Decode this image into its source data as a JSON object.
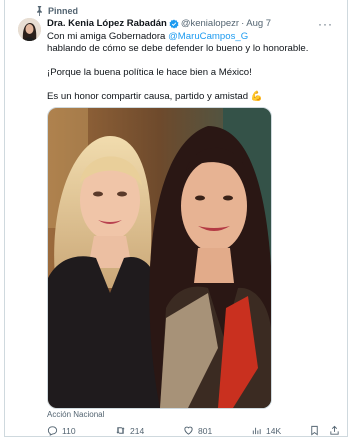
{
  "pinned_label": "Pinned",
  "author": {
    "name": "Dra. Kenia López Rabadán",
    "handle": "@kenialopezr",
    "separator": "·",
    "date": "Aug 7"
  },
  "tweet": {
    "line1_prefix": "Con mi amiga Gobernadora ",
    "mention": "@MaruCampos_G",
    "line2": "hablando de cómo se debe defender lo bueno y lo honorable.",
    "line3": "¡Porque la buena política le hace bien a México!",
    "line4": "Es un honor compartir causa, partido y amistad 💪"
  },
  "media_caption": "Acción Nacional",
  "stats": {
    "replies": "110",
    "retweets": "214",
    "likes": "801",
    "views": "14K"
  },
  "colors": {
    "accent": "#1d9bf0",
    "muted": "#536471",
    "text": "#0f1419"
  },
  "icons": [
    "pin-icon",
    "verified-badge-icon",
    "more-icon",
    "reply-icon",
    "retweet-icon",
    "like-icon",
    "views-icon",
    "bookmark-icon",
    "share-icon"
  ]
}
